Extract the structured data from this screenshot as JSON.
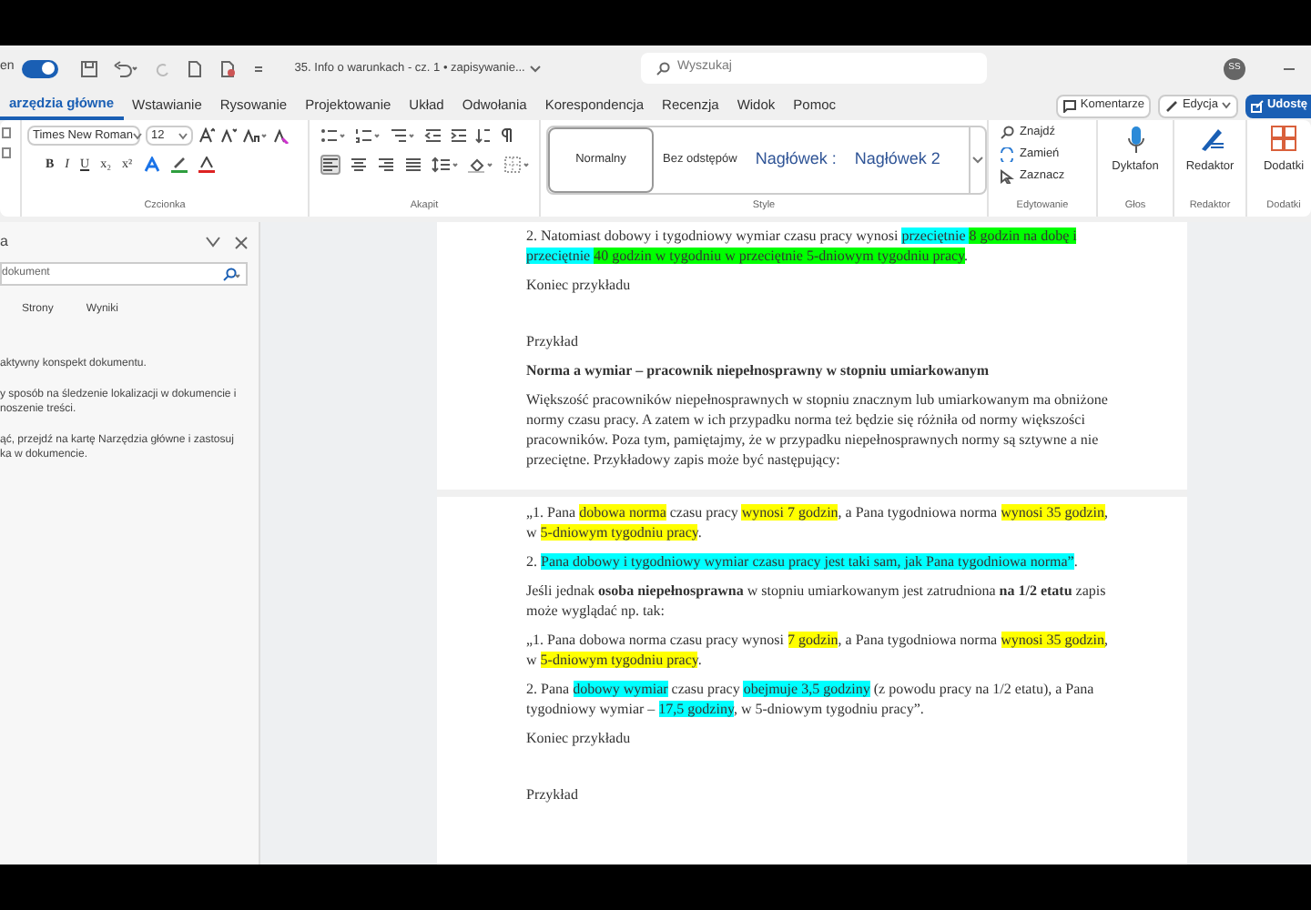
{
  "title_bar": {
    "autosave_label": "en",
    "autosave_on": true,
    "document_title": "35. Info o warunkach - cz. 1 • zapisywanie...",
    "search_placeholder": "Wyszukaj",
    "avatar_initials": "SS"
  },
  "ribbon_tabs": [
    {
      "label": "arzędzia główne",
      "selected": true
    },
    {
      "label": "Wstawianie",
      "selected": false
    },
    {
      "label": "Rysowanie",
      "selected": false
    },
    {
      "label": "Projektowanie",
      "selected": false
    },
    {
      "label": "Układ",
      "selected": false
    },
    {
      "label": "Odwołania",
      "selected": false
    },
    {
      "label": "Korespondencja",
      "selected": false
    },
    {
      "label": "Recenzja",
      "selected": false
    },
    {
      "label": "Widok",
      "selected": false
    },
    {
      "label": "Pomoc",
      "selected": false
    }
  ],
  "ribbon_actions": {
    "comments": "Komentarze",
    "editing": "Edycja",
    "share": "Udostę"
  },
  "ribbon": {
    "font_name": "Times New Roman",
    "font_size": "12",
    "format_buttons": [
      "B",
      "I",
      "U",
      "x₂",
      "x²"
    ],
    "groups": [
      "Czcionka",
      "Akapit",
      "Style",
      "Edytowanie",
      "Głos",
      "Redaktor",
      "Dodatki"
    ],
    "styles": [
      {
        "label": "Normalny",
        "selected": true
      },
      {
        "label": "Bez odstępów",
        "selected": false
      },
      {
        "label": "Nagłówek :",
        "selected": false
      },
      {
        "label": "Nagłówek 2",
        "selected": false
      }
    ],
    "editing": [
      "Znajdź",
      "Zamień",
      "Zaznacz"
    ],
    "dictate": "Dyktafon",
    "editor": "Redaktor",
    "addins": "Dodatki"
  },
  "nav_pane": {
    "title": "a",
    "search_placeholder": "dokument",
    "tabs": [
      {
        "label": "Strony",
        "selected": false
      },
      {
        "label": "Wyniki",
        "selected": false
      }
    ],
    "hints": [
      "aktywny konspekt dokumentu.",
      "y sposób na śledzenie lokalizacji w dokumencie i\nnoszenie treści.",
      "ąć, przejdź na kartę Narzędzia główne i zastosuj\nka w dokumencie."
    ]
  },
  "pages": [
    {
      "paragraphs": [
        {
          "kind": "body",
          "runs": [
            {
              "text": "2. Natomiast dobowy i tygodniowy wymiar czasu pracy wynosi "
            },
            {
              "text": "przeciętnie ",
              "color": "#00ffff"
            },
            {
              "text": "8 godzin na dobę i ",
              "color": "#00ff00"
            },
            {
              "text": "przeciętnie ",
              "color": "#00ffff"
            },
            {
              "text": "40 godzin w tygodniu w przeciętnie 5-dniowym tygodniu pracy",
              "color": "#00ff00"
            },
            {
              "text": "."
            }
          ]
        },
        {
          "kind": "body",
          "runs": [
            {
              "text": "Koniec przykładu"
            }
          ]
        },
        {
          "kind": "label",
          "runs": [
            {
              "text": "Przykład"
            }
          ]
        },
        {
          "kind": "heading",
          "runs": [
            {
              "text": "Norma a wymiar – pracownik niepełnosprawny w stopniu umiarkowanym"
            }
          ]
        },
        {
          "kind": "body",
          "runs": [
            {
              "text": "Większość pracowników niepełnosprawnych w stopniu znacznym lub umiarkowanym ma obniżone normy czasu pracy. A zatem w ich przypadku norma też będzie się różniła od normy większości pracowników. Poza tym, pamiętajmy, że w przypadku niepełnosprawnych normy są sztywne a nie przeciętne. Przykładowy zapis może być następujący:"
            }
          ]
        }
      ]
    },
    {
      "paragraphs": [
        {
          "kind": "body",
          "runs": [
            {
              "text": "„1. Pana "
            },
            {
              "text": "dobowa norma",
              "color": "#ffff00"
            },
            {
              "text": " czasu pracy "
            },
            {
              "text": "wynosi 7 godzin",
              "color": "#ffff00"
            },
            {
              "text": ", a Pana tygodniowa norma "
            },
            {
              "text": "wynosi 35 godzin",
              "color": "#ffff00"
            },
            {
              "text": ", w "
            },
            {
              "text": "5-dniowym tygodniu pracy",
              "color": "#ffff00"
            },
            {
              "text": "."
            }
          ]
        },
        {
          "kind": "body",
          "runs": [
            {
              "text": "2. "
            },
            {
              "text": "Pana dobowy i tygodniowy wymiar czasu pracy jest taki sam, jak Pana tygodniowa norma”",
              "color": "#00ffff"
            },
            {
              "text": "."
            }
          ]
        },
        {
          "kind": "body",
          "runs": [
            {
              "text": "Jeśli jednak **osoba niepełnosprawna** w stopniu umiarkowanym jest zatrudniona **na 1/2 etatu** zapis może wyglądać np. tak:"
            }
          ]
        },
        {
          "kind": "body",
          "runs": [
            {
              "text": "„1. Pana dobowa norma czasu pracy wynosi "
            },
            {
              "text": "7 godzin",
              "color": "#ffff00"
            },
            {
              "text": ", a Pana tygodniowa norma "
            },
            {
              "text": "wynosi 35 godzin",
              "color": "#ffff00"
            },
            {
              "text": ", w "
            },
            {
              "text": "5-dniowym tygodniu pracy",
              "color": "#ffff00"
            },
            {
              "text": "."
            }
          ]
        },
        {
          "kind": "body",
          "runs": [
            {
              "text": "2. Pana "
            },
            {
              "text": "dobowy wymiar",
              "color": "#00ffff"
            },
            {
              "text": " czasu pracy "
            },
            {
              "text": "obejmuje 3,5 godziny",
              "color": "#00ffff"
            },
            {
              "text": " (z powodu pracy na 1/2 etatu), a Pana tygodniowy wymiar – "
            },
            {
              "text": "17,5 godziny",
              "color": "#00ffff"
            },
            {
              "text": ", w 5-dniowym tygodniu pracy”."
            }
          ]
        },
        {
          "kind": "body",
          "runs": [
            {
              "text": "Koniec przykładu"
            }
          ]
        },
        {
          "kind": "label",
          "runs": [
            {
              "text": "Przykład"
            }
          ]
        }
      ]
    }
  ]
}
